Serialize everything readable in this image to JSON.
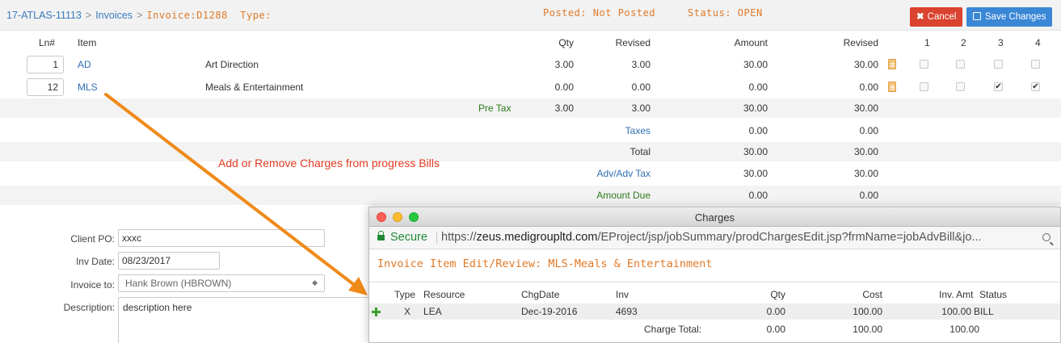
{
  "header": {
    "breadcrumb": [
      "17-ATLAS-11113",
      "Invoices"
    ],
    "invoice_label": "Invoice:D1288",
    "type_label": "Type:",
    "posted": "Posted: Not Posted",
    "status": "Status: OPEN",
    "cancel_label": "Cancel",
    "save_label": "Save Changes",
    "cancel_icon": "close-icon",
    "save_icon": "floppy-disk-icon"
  },
  "table": {
    "columns": {
      "ln": "Ln#",
      "item": "Item",
      "qty": "Qty",
      "revised_qty": "Revised",
      "amount": "Amount",
      "revised_amount": "Revised",
      "bill1": "1",
      "bill2": "2",
      "bill3": "3",
      "bill4": "4"
    },
    "rows": [
      {
        "ln": "1",
        "code": "AD",
        "desc": "Art Direction",
        "qty": "3.00",
        "revised_qty": "3.00",
        "amount": "30.00",
        "revised_amount": "30.00",
        "bills": [
          false,
          false,
          false,
          false
        ]
      },
      {
        "ln": "12",
        "code": "MLS",
        "desc": "Meals & Entertainment",
        "qty": "0.00",
        "revised_qty": "0.00",
        "amount": "0.00",
        "revised_amount": "0.00",
        "bills": [
          false,
          false,
          true,
          true
        ]
      }
    ],
    "pretax": {
      "label": "Pre Tax",
      "qty": "3.00",
      "revised_qty": "3.00",
      "amount": "30.00",
      "revised_amount": "30.00"
    },
    "taxes": {
      "label": "Taxes",
      "amount": "0.00",
      "revised_amount": "0.00"
    },
    "total": {
      "label": "Total",
      "amount": "30.00",
      "revised_amount": "30.00"
    },
    "adv_tax": {
      "label": "Adv/Adv Tax",
      "amount": "30.00",
      "revised_amount": "30.00"
    },
    "amount_due": {
      "label": "Amount Due",
      "amount": "0.00",
      "revised_amount": "0.00"
    }
  },
  "annotation": "Add or Remove Charges from progress Bills",
  "form": {
    "client_po_label": "Client PO:",
    "client_po_value": "xxxc",
    "inv_date_label": "Inv Date:",
    "inv_date_value": "08/23/2017",
    "invoice_to_label": "Invoice to:",
    "invoice_to_value": "Hank Brown (HBROWN)",
    "description_label": "Description:",
    "description_value": "description here"
  },
  "popup": {
    "title": "Charges",
    "secure_label": "Secure",
    "url_scheme": "https://",
    "url_host": "zeus.medigroupltd.com",
    "url_path": "/EProject/jsp/jobSummary/prodChargesEdit.jsp?frmName=jobAdvBill&jo...",
    "heading": "Invoice Item Edit/Review: MLS-Meals & Entertainment",
    "columns": {
      "type": "Type",
      "resource": "Resource",
      "chgdate": "ChgDate",
      "inv": "Inv",
      "qty": "Qty",
      "cost": "Cost",
      "inv_amt": "Inv. Amt",
      "status": "Status"
    },
    "rows": [
      {
        "type": "X",
        "resource": "LEA",
        "chgdate": "Dec-19-2016",
        "inv": "4693",
        "qty": "0.00",
        "cost": "100.00",
        "inv_amt": "100.00",
        "status": "BILL"
      }
    ],
    "total": {
      "label": "Charge Total:",
      "qty": "0.00",
      "cost": "100.00",
      "inv_amt": "100.00"
    }
  }
}
